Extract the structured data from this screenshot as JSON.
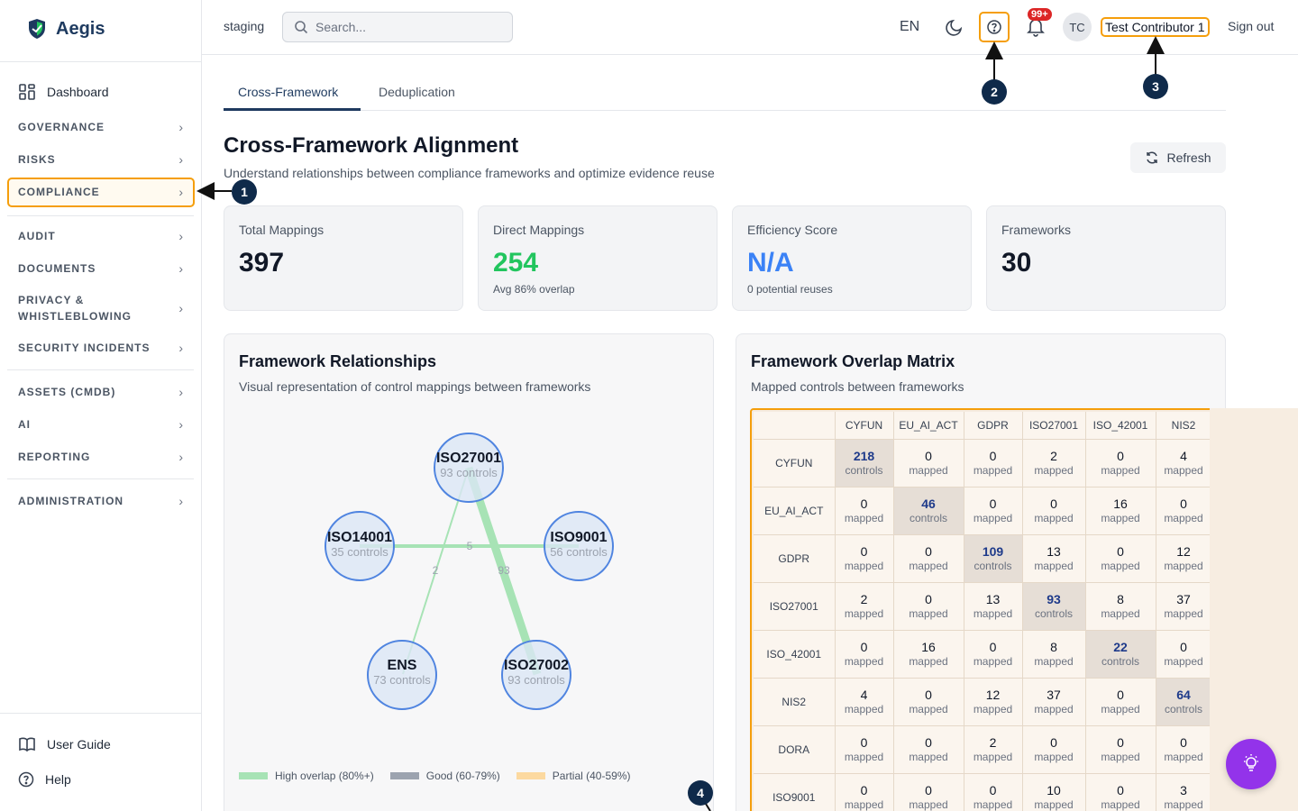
{
  "brand": {
    "name": "Aegis"
  },
  "sidebar": {
    "dashboard": "Dashboard",
    "sections": [
      {
        "label": "GOVERNANCE"
      },
      {
        "label": "RISKS"
      },
      {
        "label": "COMPLIANCE"
      },
      {
        "label": "AUDIT"
      },
      {
        "label": "DOCUMENTS"
      },
      {
        "label": "PRIVACY &"
      },
      {
        "label": "WHISTLEBLOWING"
      },
      {
        "label": "SECURITY INCIDENTS"
      },
      {
        "label": "ASSETS (CMDB)"
      },
      {
        "label": "AI"
      },
      {
        "label": "REPORTING"
      },
      {
        "label": "ADMINISTRATION"
      }
    ],
    "user_guide": "User Guide",
    "help": "Help"
  },
  "header": {
    "environment": "staging",
    "search_placeholder": "Search...",
    "language": "EN",
    "notification_count": "99+",
    "avatar_initials": "TC",
    "user_name": "Test Contributor 1",
    "sign_out": "Sign out"
  },
  "tabs": [
    {
      "label": "Cross-Framework",
      "active": true
    },
    {
      "label": "Deduplication",
      "active": false
    }
  ],
  "page": {
    "title": "Cross-Framework Alignment",
    "subtitle": "Understand relationships between compliance frameworks and optimize evidence reuse",
    "refresh": "Refresh"
  },
  "stats": [
    {
      "label": "Total Mappings",
      "value": "397",
      "note": "",
      "color": "#111827"
    },
    {
      "label": "Direct Mappings",
      "value": "254",
      "note": "Avg 86% overlap",
      "color": "#22c55e"
    },
    {
      "label": "Efficiency Score",
      "value": "N/A",
      "note": "0 potential reuses",
      "color": "#3b82f6"
    },
    {
      "label": "Frameworks",
      "value": "30",
      "note": "",
      "color": "#111827"
    }
  ],
  "relationships": {
    "title": "Framework Relationships",
    "subtitle": "Visual representation of control mappings between frameworks",
    "nodes": [
      {
        "name": "ISO27001",
        "controls": "93 controls"
      },
      {
        "name": "ISO14001",
        "controls": "35 controls"
      },
      {
        "name": "ISO9001",
        "controls": "56 controls"
      },
      {
        "name": "ENS",
        "controls": "73 controls"
      },
      {
        "name": "ISO27002",
        "controls": "93 controls"
      }
    ],
    "edges": [
      {
        "from": "ISO14001",
        "to": "ISO9001",
        "label": "5"
      },
      {
        "from": "ISO27001",
        "to": "ENS",
        "label": "2"
      },
      {
        "from": "ISO27001",
        "to": "ISO27002",
        "label": "93"
      }
    ],
    "legend": [
      {
        "label": "High overlap (80%+)",
        "color": "#a7e3b5"
      },
      {
        "label": "Good (60-79%)",
        "color": "#9ca3af"
      },
      {
        "label": "Partial (40-59%)",
        "color": "#fcd9a0"
      }
    ]
  },
  "matrix": {
    "title": "Framework Overlap Matrix",
    "subtitle": "Mapped controls between frameworks",
    "columns": [
      "CYFUN",
      "EU_AI_ACT",
      "GDPR",
      "ISO27001",
      "ISO_42001",
      "NIS2"
    ],
    "rows": [
      {
        "name": "CYFUN",
        "cells": [
          {
            "n": "218",
            "t": "controls"
          },
          {
            "n": "0",
            "t": "mapped"
          },
          {
            "n": "0",
            "t": "mapped"
          },
          {
            "n": "2",
            "t": "mapped"
          },
          {
            "n": "0",
            "t": "mapped"
          },
          {
            "n": "4",
            "t": "mapped"
          }
        ]
      },
      {
        "name": "EU_AI_ACT",
        "cells": [
          {
            "n": "0",
            "t": "mapped"
          },
          {
            "n": "46",
            "t": "controls"
          },
          {
            "n": "0",
            "t": "mapped"
          },
          {
            "n": "0",
            "t": "mapped"
          },
          {
            "n": "16",
            "t": "mapped"
          },
          {
            "n": "0",
            "t": "mapped"
          }
        ]
      },
      {
        "name": "GDPR",
        "cells": [
          {
            "n": "0",
            "t": "mapped"
          },
          {
            "n": "0",
            "t": "mapped"
          },
          {
            "n": "109",
            "t": "controls"
          },
          {
            "n": "13",
            "t": "mapped"
          },
          {
            "n": "0",
            "t": "mapped"
          },
          {
            "n": "12",
            "t": "mapped"
          }
        ]
      },
      {
        "name": "ISO27001",
        "cells": [
          {
            "n": "2",
            "t": "mapped"
          },
          {
            "n": "0",
            "t": "mapped"
          },
          {
            "n": "13",
            "t": "mapped"
          },
          {
            "n": "93",
            "t": "controls"
          },
          {
            "n": "8",
            "t": "mapped"
          },
          {
            "n": "37",
            "t": "mapped"
          }
        ]
      },
      {
        "name": "ISO_42001",
        "cells": [
          {
            "n": "0",
            "t": "mapped"
          },
          {
            "n": "16",
            "t": "mapped"
          },
          {
            "n": "0",
            "t": "mapped"
          },
          {
            "n": "8",
            "t": "mapped"
          },
          {
            "n": "22",
            "t": "controls"
          },
          {
            "n": "0",
            "t": "mapped"
          }
        ]
      },
      {
        "name": "NIS2",
        "cells": [
          {
            "n": "4",
            "t": "mapped"
          },
          {
            "n": "0",
            "t": "mapped"
          },
          {
            "n": "12",
            "t": "mapped"
          },
          {
            "n": "37",
            "t": "mapped"
          },
          {
            "n": "0",
            "t": "mapped"
          },
          {
            "n": "64",
            "t": "controls"
          }
        ]
      },
      {
        "name": "DORA",
        "cells": [
          {
            "n": "0",
            "t": "mapped"
          },
          {
            "n": "0",
            "t": "mapped"
          },
          {
            "n": "2",
            "t": "mapped"
          },
          {
            "n": "0",
            "t": "mapped"
          },
          {
            "n": "0",
            "t": "mapped"
          },
          {
            "n": "0",
            "t": "mapped"
          }
        ]
      },
      {
        "name": "ISO9001",
        "cells": [
          {
            "n": "0",
            "t": "mapped"
          },
          {
            "n": "0",
            "t": "mapped"
          },
          {
            "n": "0",
            "t": "mapped"
          },
          {
            "n": "10",
            "t": "mapped"
          },
          {
            "n": "0",
            "t": "mapped"
          },
          {
            "n": "3",
            "t": "mapped"
          }
        ]
      }
    ]
  },
  "callouts": [
    "1",
    "2",
    "3",
    "4"
  ],
  "colors": {
    "accent": "#1e3a5f",
    "highlight": "#f59e0b",
    "fab": "#9333ea"
  }
}
